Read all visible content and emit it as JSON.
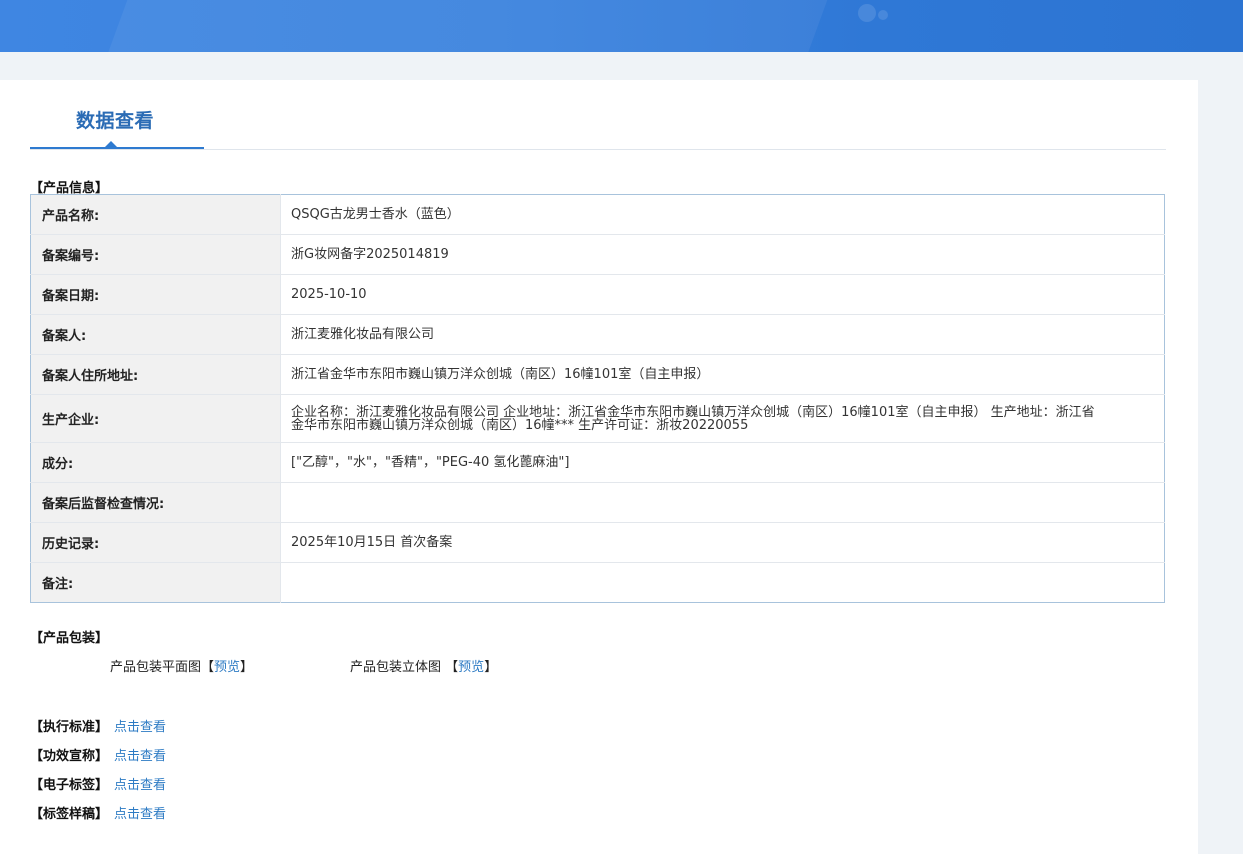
{
  "page": {
    "tab_title": "数据查看"
  },
  "product_info": {
    "section_title": "【产品信息】",
    "rows": [
      {
        "label": "产品名称:",
        "value": "QSQG古龙男士香水（蓝色）"
      },
      {
        "label": "备案编号:",
        "value": "浙G妆网备字2025014819"
      },
      {
        "label": "备案日期:",
        "value": "2025-10-10"
      },
      {
        "label": "备案人:",
        "value": "浙江麦雅化妆品有限公司"
      },
      {
        "label": "备案人住所地址:",
        "value": "浙江省金华市东阳市巍山镇万洋众创城（南区）16幢101室（自主申报）"
      },
      {
        "label": "生产企业:",
        "value": "企业名称：浙江麦雅化妆品有限公司 企业地址：浙江省金华市东阳市巍山镇万洋众创城（南区）16幢101室（自主申报） 生产地址：浙江省金华市东阳市巍山镇万洋众创城（南区）16幢*** 生产许可证：浙妆20220055"
      },
      {
        "label": "成分:",
        "value": "[\"乙醇\"，\"水\"，\"香精\"，\"PEG-40 氢化蓖麻油\"]"
      },
      {
        "label": "备案后监督检查情况:",
        "value": ""
      },
      {
        "label": "历史记录:",
        "value": "2025年10月15日 首次备案"
      },
      {
        "label": "备注:",
        "value": ""
      }
    ]
  },
  "packaging": {
    "section_title": "【产品包装】",
    "flat_label": "产品包装平面图",
    "flat_link": "预览",
    "stereo_label": "产品包装立体图",
    "stereo_link": "预览",
    "open_bracket": "【",
    "close_bracket": "】"
  },
  "documents": [
    {
      "label": "【执行标准】",
      "link": "点击查看"
    },
    {
      "label": "【功效宣称】",
      "link": "点击查看"
    },
    {
      "label": "【电子标签】",
      "link": "点击查看"
    },
    {
      "label": "【标签样稿】",
      "link": "点击查看"
    }
  ]
}
